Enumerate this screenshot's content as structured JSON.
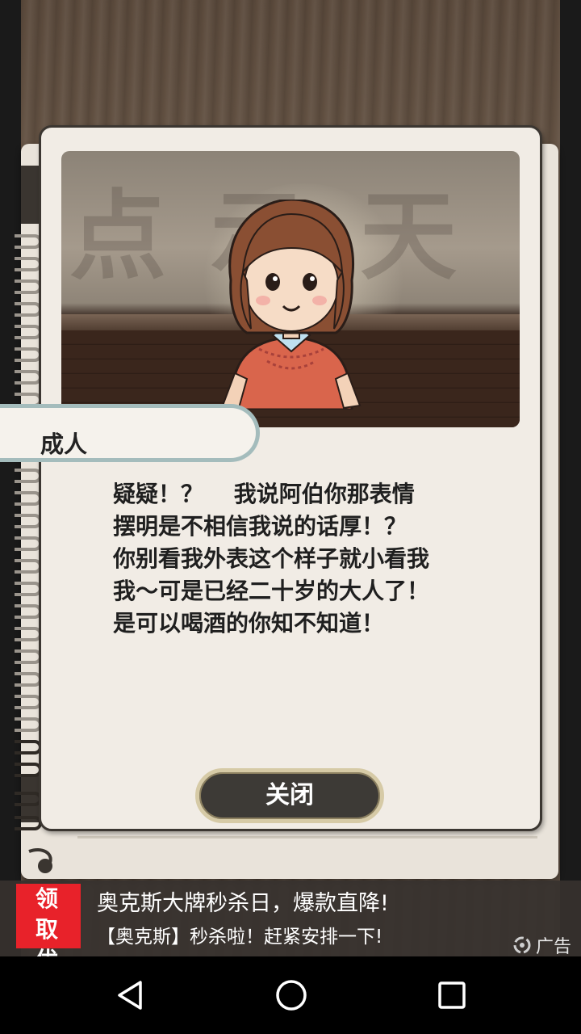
{
  "dialog": {
    "character_name": "成人",
    "lines": [
      "疑疑！？　 我说阿伯你那表情",
      "摆明是不相信我说的话厚！？",
      "你别看我外表这个样子就小看我",
      "我～可是已经二十岁的大人了！",
      "是可以喝酒的你知不知道！"
    ],
    "close_label": "关闭"
  },
  "scene": {
    "sign_chars": [
      "点",
      "示",
      "天"
    ],
    "icon": "girl-character-portrait"
  },
  "ad": {
    "badge_line1": "领 取",
    "badge_line2": "优 惠",
    "headline": "奥克斯大牌秒杀日，爆款直降!",
    "subline": "【奥克斯】秒杀啦！赶紧安排一下!",
    "tag": "广告",
    "badge_color": "#e8222a"
  },
  "nav": {
    "back_icon": "back-triangle-icon",
    "home_icon": "home-circle-icon",
    "recents_icon": "recents-square-icon"
  }
}
